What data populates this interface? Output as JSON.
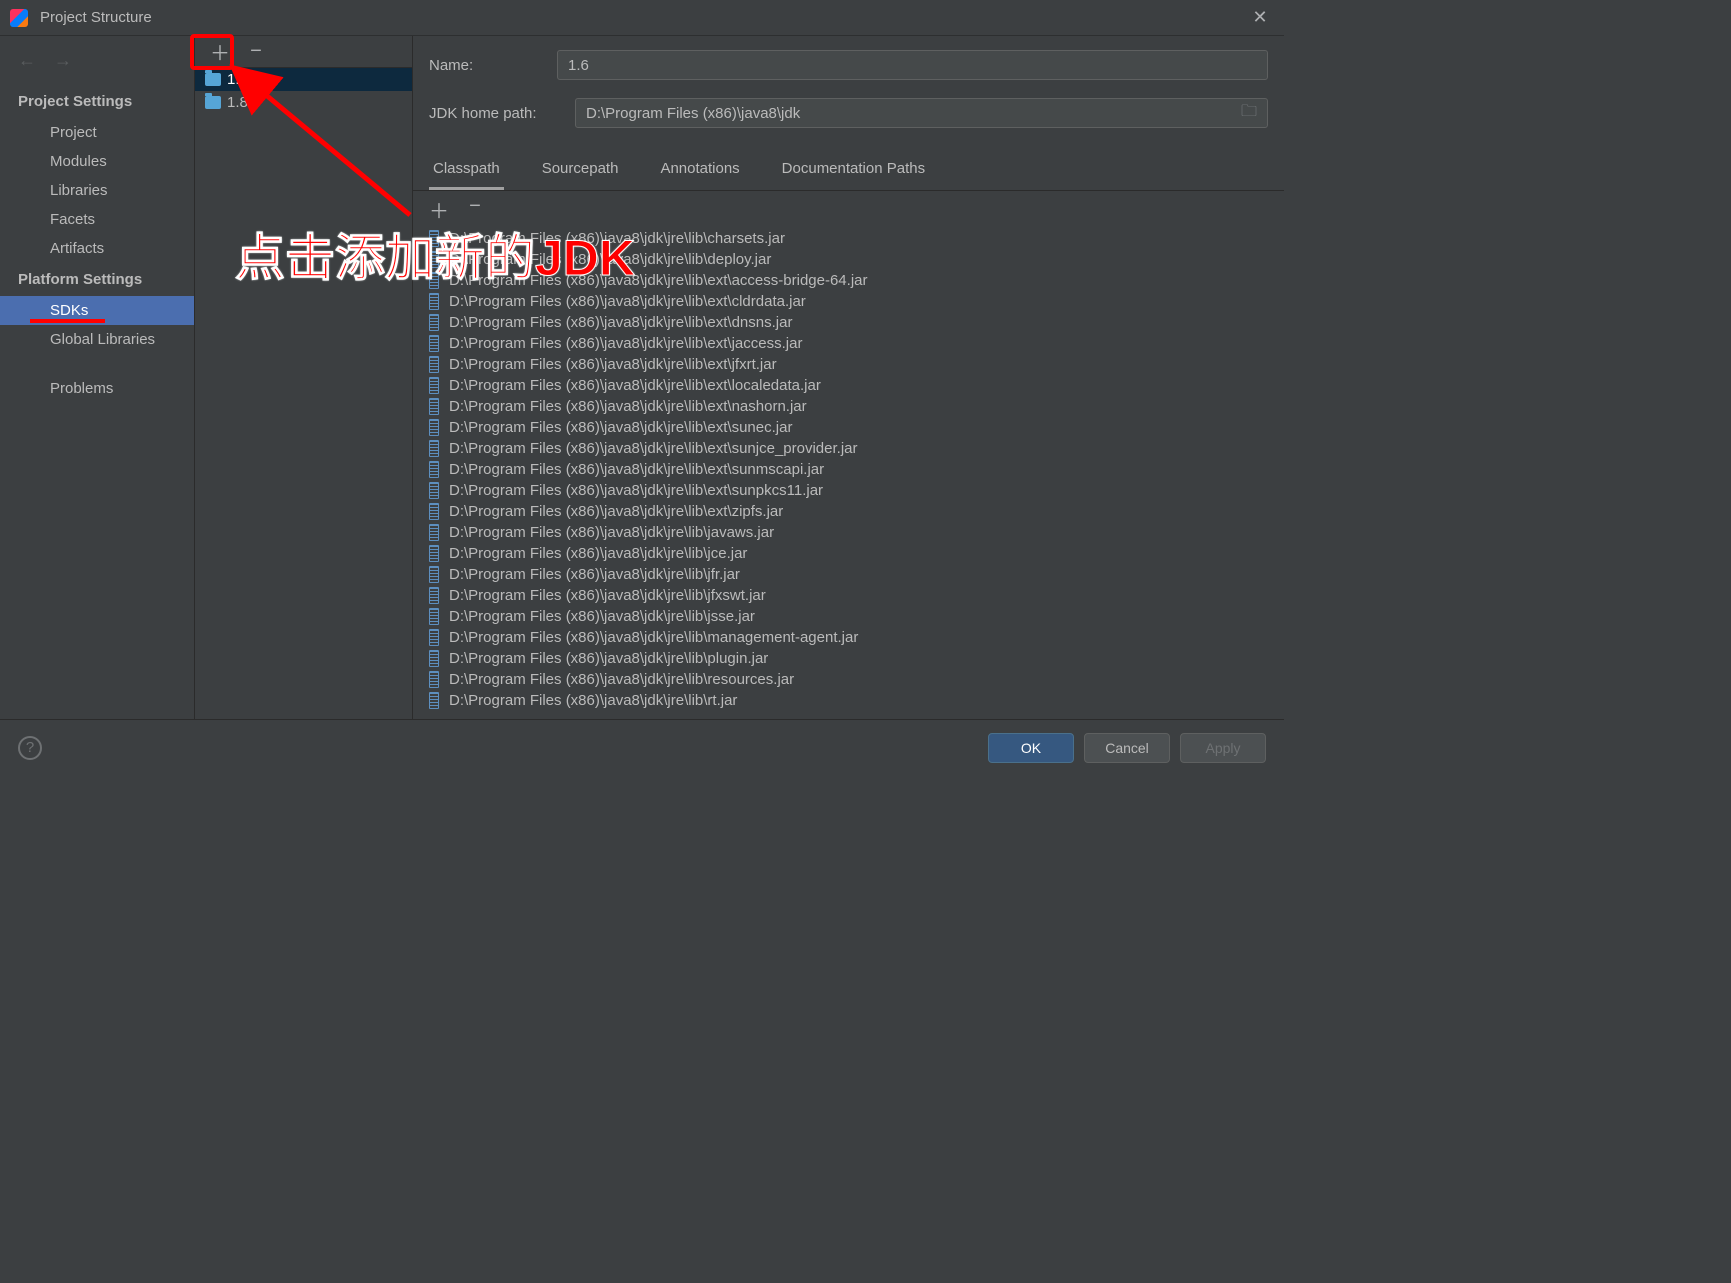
{
  "titlebar": {
    "title": "Project Structure"
  },
  "nav": {
    "section1": "Project Settings",
    "items1": [
      "Project",
      "Modules",
      "Libraries",
      "Facets",
      "Artifacts"
    ],
    "section2": "Platform Settings",
    "items2": [
      "SDKs",
      "Global Libraries"
    ],
    "section3_item": "Problems"
  },
  "sdks": {
    "items": [
      "1.6",
      "1.8"
    ]
  },
  "form": {
    "name_label": "Name:",
    "name_value": "1.6",
    "path_label": "JDK home path:",
    "path_value": "D:\\Program Files (x86)\\java8\\jdk"
  },
  "tabs": [
    "Classpath",
    "Sourcepath",
    "Annotations",
    "Documentation Paths"
  ],
  "classpath": [
    "D:\\Program Files (x86)\\java8\\jdk\\jre\\lib\\charsets.jar",
    "D:\\Program Files (x86)\\java8\\jdk\\jre\\lib\\deploy.jar",
    "D:\\Program Files (x86)\\java8\\jdk\\jre\\lib\\ext\\access-bridge-64.jar",
    "D:\\Program Files (x86)\\java8\\jdk\\jre\\lib\\ext\\cldrdata.jar",
    "D:\\Program Files (x86)\\java8\\jdk\\jre\\lib\\ext\\dnsns.jar",
    "D:\\Program Files (x86)\\java8\\jdk\\jre\\lib\\ext\\jaccess.jar",
    "D:\\Program Files (x86)\\java8\\jdk\\jre\\lib\\ext\\jfxrt.jar",
    "D:\\Program Files (x86)\\java8\\jdk\\jre\\lib\\ext\\localedata.jar",
    "D:\\Program Files (x86)\\java8\\jdk\\jre\\lib\\ext\\nashorn.jar",
    "D:\\Program Files (x86)\\java8\\jdk\\jre\\lib\\ext\\sunec.jar",
    "D:\\Program Files (x86)\\java8\\jdk\\jre\\lib\\ext\\sunjce_provider.jar",
    "D:\\Program Files (x86)\\java8\\jdk\\jre\\lib\\ext\\sunmscapi.jar",
    "D:\\Program Files (x86)\\java8\\jdk\\jre\\lib\\ext\\sunpkcs11.jar",
    "D:\\Program Files (x86)\\java8\\jdk\\jre\\lib\\ext\\zipfs.jar",
    "D:\\Program Files (x86)\\java8\\jdk\\jre\\lib\\javaws.jar",
    "D:\\Program Files (x86)\\java8\\jdk\\jre\\lib\\jce.jar",
    "D:\\Program Files (x86)\\java8\\jdk\\jre\\lib\\jfr.jar",
    "D:\\Program Files (x86)\\java8\\jdk\\jre\\lib\\jfxswt.jar",
    "D:\\Program Files (x86)\\java8\\jdk\\jre\\lib\\jsse.jar",
    "D:\\Program Files (x86)\\java8\\jdk\\jre\\lib\\management-agent.jar",
    "D:\\Program Files (x86)\\java8\\jdk\\jre\\lib\\plugin.jar",
    "D:\\Program Files (x86)\\java8\\jdk\\jre\\lib\\resources.jar",
    "D:\\Program Files (x86)\\java8\\jdk\\jre\\lib\\rt.jar"
  ],
  "footer": {
    "ok": "OK",
    "cancel": "Cancel",
    "apply": "Apply"
  },
  "annotation": "点击添加新的JDK"
}
